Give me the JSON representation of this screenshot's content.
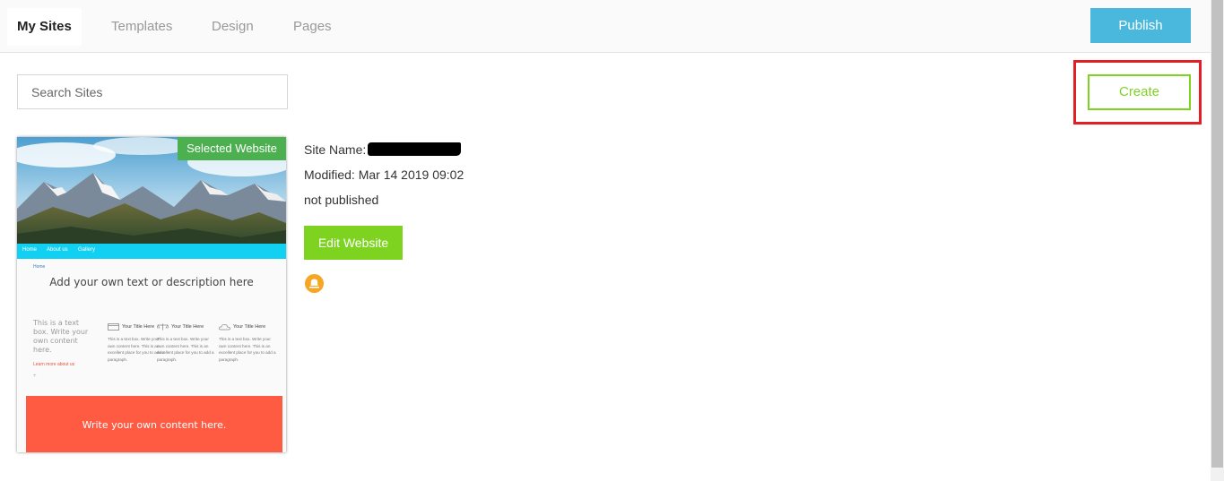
{
  "nav": {
    "tabs": [
      "My Sites",
      "Templates",
      "Design",
      "Pages"
    ],
    "publish_label": "Publish"
  },
  "search": {
    "placeholder": "Search Sites"
  },
  "create_label": "Create",
  "site": {
    "selected_badge": "Selected Website",
    "name_label": "Site Name:",
    "modified": "Modified: Mar 14 2019 09:02",
    "status": "not published",
    "edit_label": "Edit Website"
  },
  "preview": {
    "nav_items": [
      "Home",
      "About us",
      "Gallery"
    ],
    "breadcrumb": "Home",
    "heading": "Add your own text or description here",
    "textbox": "This is a text box. Write your own content here.",
    "learn_more": "Learn more about us",
    "plus": "+",
    "columns": [
      {
        "title": "Your Title Here",
        "body": "This is a text box. Write your own content here. This is an excellent place for you to add a paragraph."
      },
      {
        "title": "Your Title Here",
        "body": "This is a text box. Write your own content here. This is an excellent place for you to add a paragraph."
      },
      {
        "title": "Your Title Here",
        "body": "This is a text box. Write your own content here. This is an excellent place for you to add a paragraph."
      }
    ],
    "banner": "Write your own content here."
  },
  "colors": {
    "publish": "#4ab8dd",
    "create": "#7ed321",
    "highlight": "#e31e24",
    "selected": "#4caf50",
    "edit": "#7ed321",
    "notification": "#f5a623"
  },
  "icons": [
    "bell-icon",
    "card-icon",
    "scale-icon",
    "cloud-icon"
  ]
}
